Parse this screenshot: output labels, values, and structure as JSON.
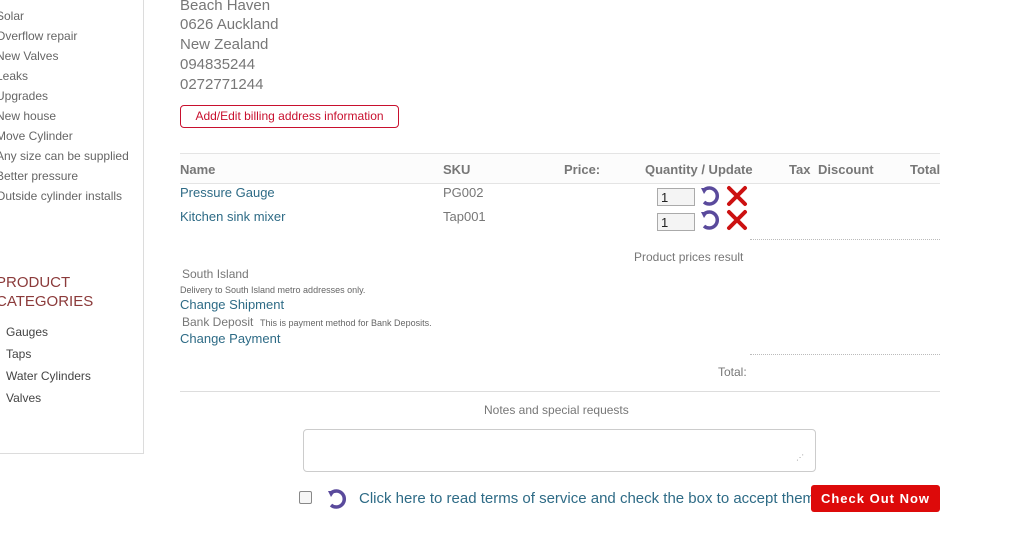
{
  "sidebar": {
    "links": [
      {
        "label": "Solar"
      },
      {
        "label": "Overflow repair"
      },
      {
        "label": "New Valves"
      },
      {
        "label": "Leaks"
      },
      {
        "label": "Upgrades"
      },
      {
        "label": "New house"
      },
      {
        "label": "Move Cylinder"
      },
      {
        "label": "Any size can be supplied"
      },
      {
        "label": "Better pressure"
      },
      {
        "label": "Outside cylinder installs"
      }
    ],
    "categories_title": "PRODUCT CATEGORIES",
    "categories": [
      {
        "label": "Gauges"
      },
      {
        "label": "Taps"
      },
      {
        "label": "Water Cylinders"
      },
      {
        "label": "Valves"
      }
    ]
  },
  "address": {
    "lines": [
      "Beach Haven",
      "0626 Auckland",
      "New Zealand",
      "094835244",
      "0272771244"
    ],
    "edit_billing_label": "Add/Edit billing address information"
  },
  "table": {
    "headers": {
      "name": "Name",
      "sku": "SKU",
      "price": "Price:",
      "quantity": "Quantity / Update",
      "tax": "Tax",
      "discount": "Discount",
      "total": "Total"
    },
    "rows": [
      {
        "name": "Pressure Gauge",
        "sku": "PG002",
        "qty": "1"
      },
      {
        "name": "Kitchen sink mixer",
        "sku": "Tap001",
        "qty": "1"
      }
    ],
    "product_prices_result": "Product prices result"
  },
  "shipment": {
    "name": "South Island",
    "note": "Delivery to South Island metro addresses only.",
    "change_label": "Change Shipment"
  },
  "payment": {
    "name": "Bank Deposit",
    "note": "This is payment method for Bank Deposits.",
    "change_label": "Change Payment"
  },
  "total_label": "Total:",
  "notes": {
    "label": "Notes and special requests",
    "value": ""
  },
  "terms": {
    "label": "Click here to read terms of service and check the box to accept them.",
    "checked": false
  },
  "checkout_label": "Check Out Now",
  "colors": {
    "link_blue": "#2e6b86",
    "accent_red": "#dd0a0a",
    "category_title": "#8b3a3a",
    "refresh_purple": "#5a4a9c",
    "delete_red": "#cc1111"
  },
  "icons": {
    "update": "refresh-icon",
    "delete": "delete-x-icon",
    "resize": "resize-grip-icon"
  }
}
